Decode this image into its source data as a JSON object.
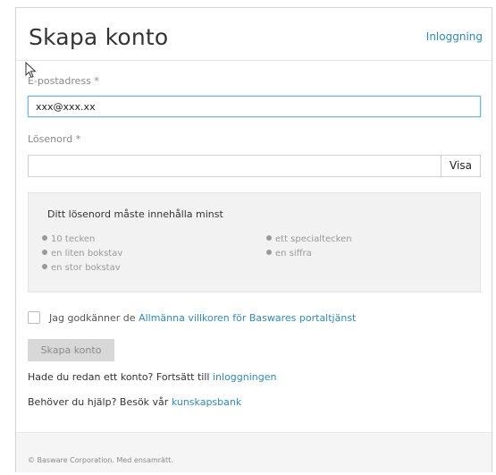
{
  "header": {
    "title": "Skapa konto",
    "login_link": "Inloggning"
  },
  "form": {
    "email": {
      "label": "E-postadress",
      "required_mark": "*",
      "value": "xxx@xxx.xx"
    },
    "password": {
      "label": "Lösenord",
      "required_mark": "*",
      "value": "",
      "show_button": "Visa"
    },
    "requirements": {
      "title": "Ditt lösenord måste innehålla minst",
      "left": [
        "10 tecken",
        "en liten bokstav",
        "en stor bokstav"
      ],
      "right": [
        "ett specialtecken",
        "en siffra"
      ]
    },
    "terms": {
      "prefix": "Jag godkänner de ",
      "link": "Allmänna villkoren för Baswares portaltjänst",
      "checked": false
    },
    "submit_label": "Skapa konto"
  },
  "info": {
    "have_account_prefix": "Hade du redan ett konto? Fortsätt till ",
    "have_account_link": "inloggningen",
    "help_prefix": "Behöver du hjälp? Besök vår ",
    "help_link": "kunskapsbank"
  },
  "footer": {
    "copyright": "© Basware Corporation. Med ensamrätt."
  },
  "colors": {
    "link": "#2b8ac4",
    "focus_border": "#6fb2e0",
    "disabled_button": "#d8d8d8",
    "requirements_bg": "#f2f2f2"
  },
  "icons": [
    "mouse-cursor-icon",
    "bullet-icon"
  ]
}
